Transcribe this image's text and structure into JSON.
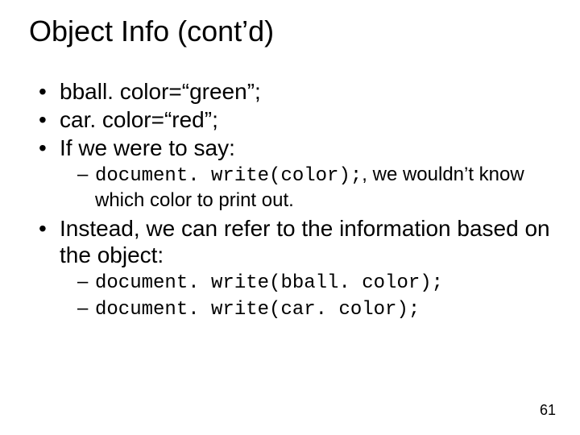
{
  "title": "Object Info (cont’d)",
  "bullets": {
    "b1": "bball. color=“green”;",
    "b2": "car. color=“red”;",
    "b3": "If we were to say:",
    "b3_sub": {
      "code": "document. write(color);",
      "punct": ",",
      "tail": " we wouldn’t know which color to print out."
    },
    "b4": "Instead, we can refer to the information based on the object:",
    "b4_sub": {
      "code1": "document. write(bball. color);",
      "code2": "document. write(car. color);"
    }
  },
  "page_number": "61"
}
